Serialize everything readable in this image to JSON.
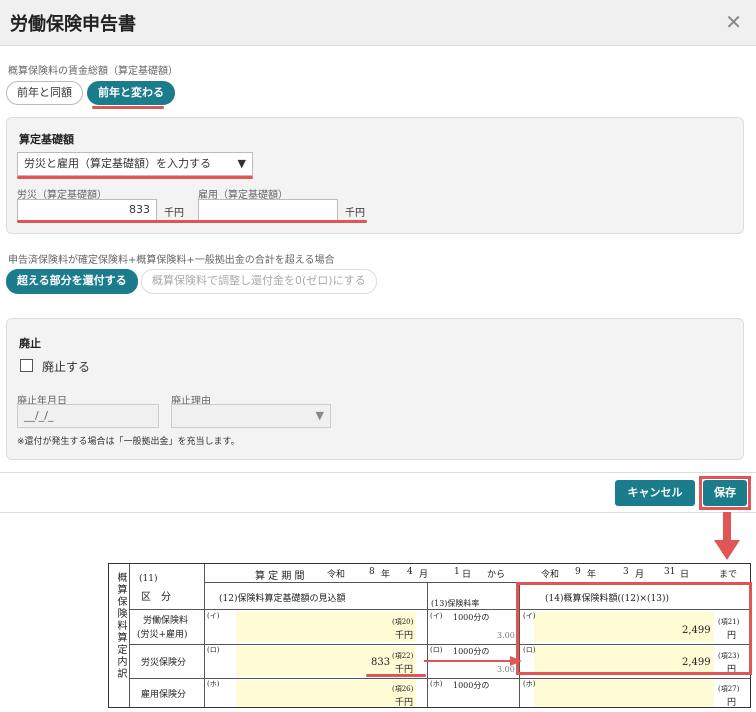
{
  "window": {
    "title": "労働保険申告書",
    "close_glyph": "✕"
  },
  "wage_section": {
    "label": "概算保険料の賃金総額（算定基礎額）",
    "option_same": "前年と同額",
    "option_changed": "前年と変わる"
  },
  "base_panel": {
    "title": "算定基礎額",
    "select_value": "労災と雇用（算定基礎額）を入力する",
    "select_arrow": "▼",
    "rousai_label": "労災（算定基礎額）",
    "rousai_value": "833",
    "rousai_unit": "千円",
    "koyou_label": "雇用（算定基礎額）",
    "koyou_value": "",
    "koyou_unit": "千円"
  },
  "refund_section": {
    "label": "申告済保険料が確定保険料+概算保険料+一般拠出金の合計を超える場合",
    "option_refund": "超える部分を還付する",
    "option_adjust": "概算保険料で調整し還付金を0(ゼロ)にする"
  },
  "abolish_panel": {
    "title": "廃止",
    "checkbox_label": "廃止する",
    "date_label": "廃止年月日",
    "date_value": "__/_/_",
    "reason_label": "廃止理由",
    "reason_arrow": "▼",
    "note": "※還付が発生する場合は「一般拠出金」を充当します。"
  },
  "footer": {
    "cancel_label": "キャンセル",
    "save_label": "保存"
  },
  "form_table": {
    "side_title": "概算保険料算定内訳",
    "col11_no": "(11)",
    "col11_label": "区　分",
    "period": {
      "label": "算 定 期 間",
      "start_era": "令和",
      "start_year": "8",
      "year_unit": "年",
      "start_month": "4",
      "month_unit": "月",
      "start_day": "1",
      "day_unit": "日",
      "from": "から",
      "end_era": "令和",
      "end_year": "9",
      "end_month": "3",
      "end_day": "31",
      "until": "まで"
    },
    "col12_header": "(12)保険料算定基礎額の見込額",
    "col13_header": "(13)保険料率",
    "col14_header": "(14)概算保険料額((12)×(13))",
    "rows": [
      {
        "name1": "労働保険料",
        "name2": "(労災+雇用)",
        "mark": "(イ)",
        "base": "",
        "base_note": "(項20)",
        "base_unit": "千円",
        "rate_prefix": "1000分の",
        "rate": "",
        "amount": "2,499",
        "amount_note": "(項21)",
        "amount_unit": "円"
      },
      {
        "name1": "労災保険分",
        "name2": "",
        "mark": "(ロ)",
        "base": "833",
        "base_note": "(項22)",
        "base_unit": "千円",
        "rate_prefix": "1000分の",
        "rate": "3.00",
        "amount": "2,499",
        "amount_note": "(項23)",
        "amount_unit": "円"
      },
      {
        "name1": "雇用保険分",
        "name2": "",
        "mark": "(ホ)",
        "base": "",
        "base_note": "(項26)",
        "base_unit": "千円",
        "rate_prefix": "1000分の",
        "rate": "",
        "amount": "",
        "amount_note": "(項27)",
        "amount_unit": "円"
      }
    ],
    "row0_rate": "3.00"
  },
  "colors": {
    "accent": "#1b7c8c",
    "highlight_red": "#e05555",
    "yellow_cell": "#fffbd4"
  }
}
